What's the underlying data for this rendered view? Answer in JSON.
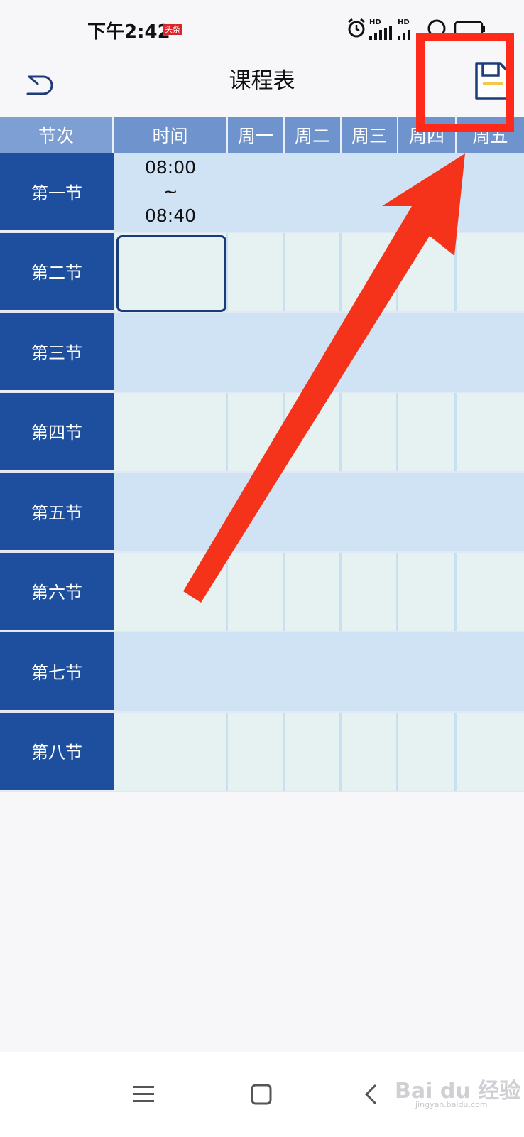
{
  "status_bar": {
    "time": "下午2:42",
    "badge": "头条",
    "hd1": "HD",
    "hd2": "HD"
  },
  "header": {
    "title": "课程表",
    "back_icon": "back-arrow-icon",
    "save_icon": "save-floppy-icon"
  },
  "table": {
    "columns": [
      "节次",
      "时间",
      "周一",
      "周二",
      "周三",
      "周四",
      "周五"
    ],
    "periods": [
      "第一节",
      "第二节",
      "第三节",
      "第四节",
      "第五节",
      "第六节",
      "第七节",
      "第八节"
    ],
    "first_time": {
      "start": "08:00",
      "sep": "~",
      "end": "08:40"
    }
  },
  "colors": {
    "header_bg": "#6f93cc",
    "period_bg": "#1d4f9e",
    "row_light": "#cfe3f5",
    "row_pale": "#e6f2f1",
    "annotation": "#ff2a1a"
  },
  "navbar": {
    "menu_icon": "menu-icon",
    "home_icon": "home-square-icon",
    "back_icon": "back-chevron-icon"
  },
  "watermark": {
    "text": "Bai du 经验",
    "sub": "jingyan.baidu.com"
  }
}
